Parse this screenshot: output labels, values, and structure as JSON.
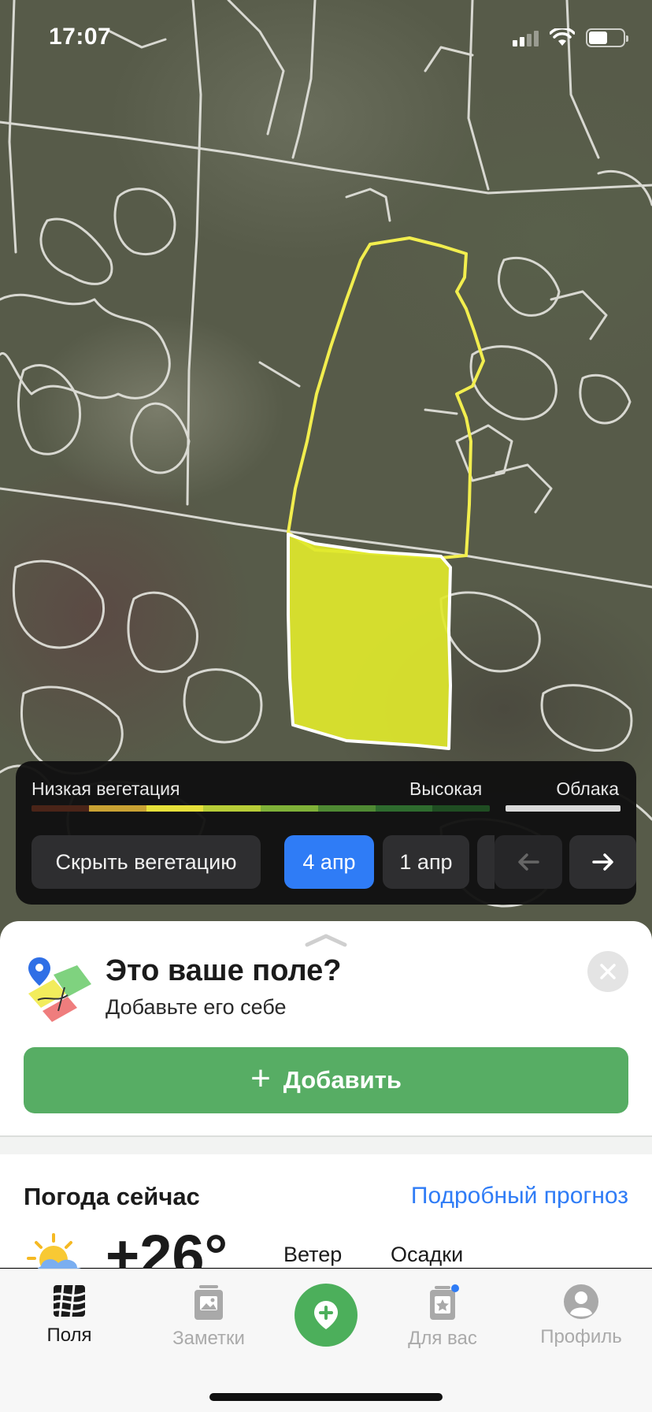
{
  "status_bar": {
    "time": "17:07",
    "icons": [
      "cellular-signal-icon",
      "wifi-icon",
      "battery-icon"
    ],
    "battery_level": 0.55
  },
  "map": {
    "field_colors": {
      "selected_fill": "#e0ea2a",
      "selected_outline": "#ffffff",
      "highlight_outline": "#f2ee4e",
      "boundary_lines": "#e6e6e0"
    }
  },
  "vegetation": {
    "low_label": "Низкая вегетация",
    "high_label": "Высокая",
    "clouds_label": "Облака",
    "scale_colors": [
      "#4a2418",
      "#c9a233",
      "#e6e03a",
      "#b7cc37",
      "#7fb138",
      "#4f8a33",
      "#2e6b2e",
      "#1f4d22"
    ],
    "hide_button": "Скрыть вегетацию",
    "dates": [
      "4 апр",
      "1 апр"
    ],
    "selected_date": "4 апр",
    "prev_icon": "arrow-left-icon",
    "next_icon": "arrow-right-icon"
  },
  "sheet": {
    "title": "Это ваше поле?",
    "subtitle": "Добавьте его себе",
    "add_button": "Добавить",
    "weather_title": "Погода сейчас",
    "forecast_link": "Подробный прогноз",
    "temperature": "+26°",
    "wind_label": "Ветер",
    "precip_label": "Осадки"
  },
  "tabs": [
    {
      "label": "Поля",
      "icon": "fields-icon",
      "active": true
    },
    {
      "label": "Заметки",
      "icon": "notes-icon",
      "active": false
    },
    {
      "label": "Для вас",
      "icon": "for-you-icon",
      "active": false,
      "badge": true
    },
    {
      "label": "Профиль",
      "icon": "profile-icon",
      "active": false
    }
  ],
  "center_button_icon": "add-location-icon",
  "accent_colors": {
    "primary": "#2f7cf6",
    "green": "#57ad64"
  }
}
